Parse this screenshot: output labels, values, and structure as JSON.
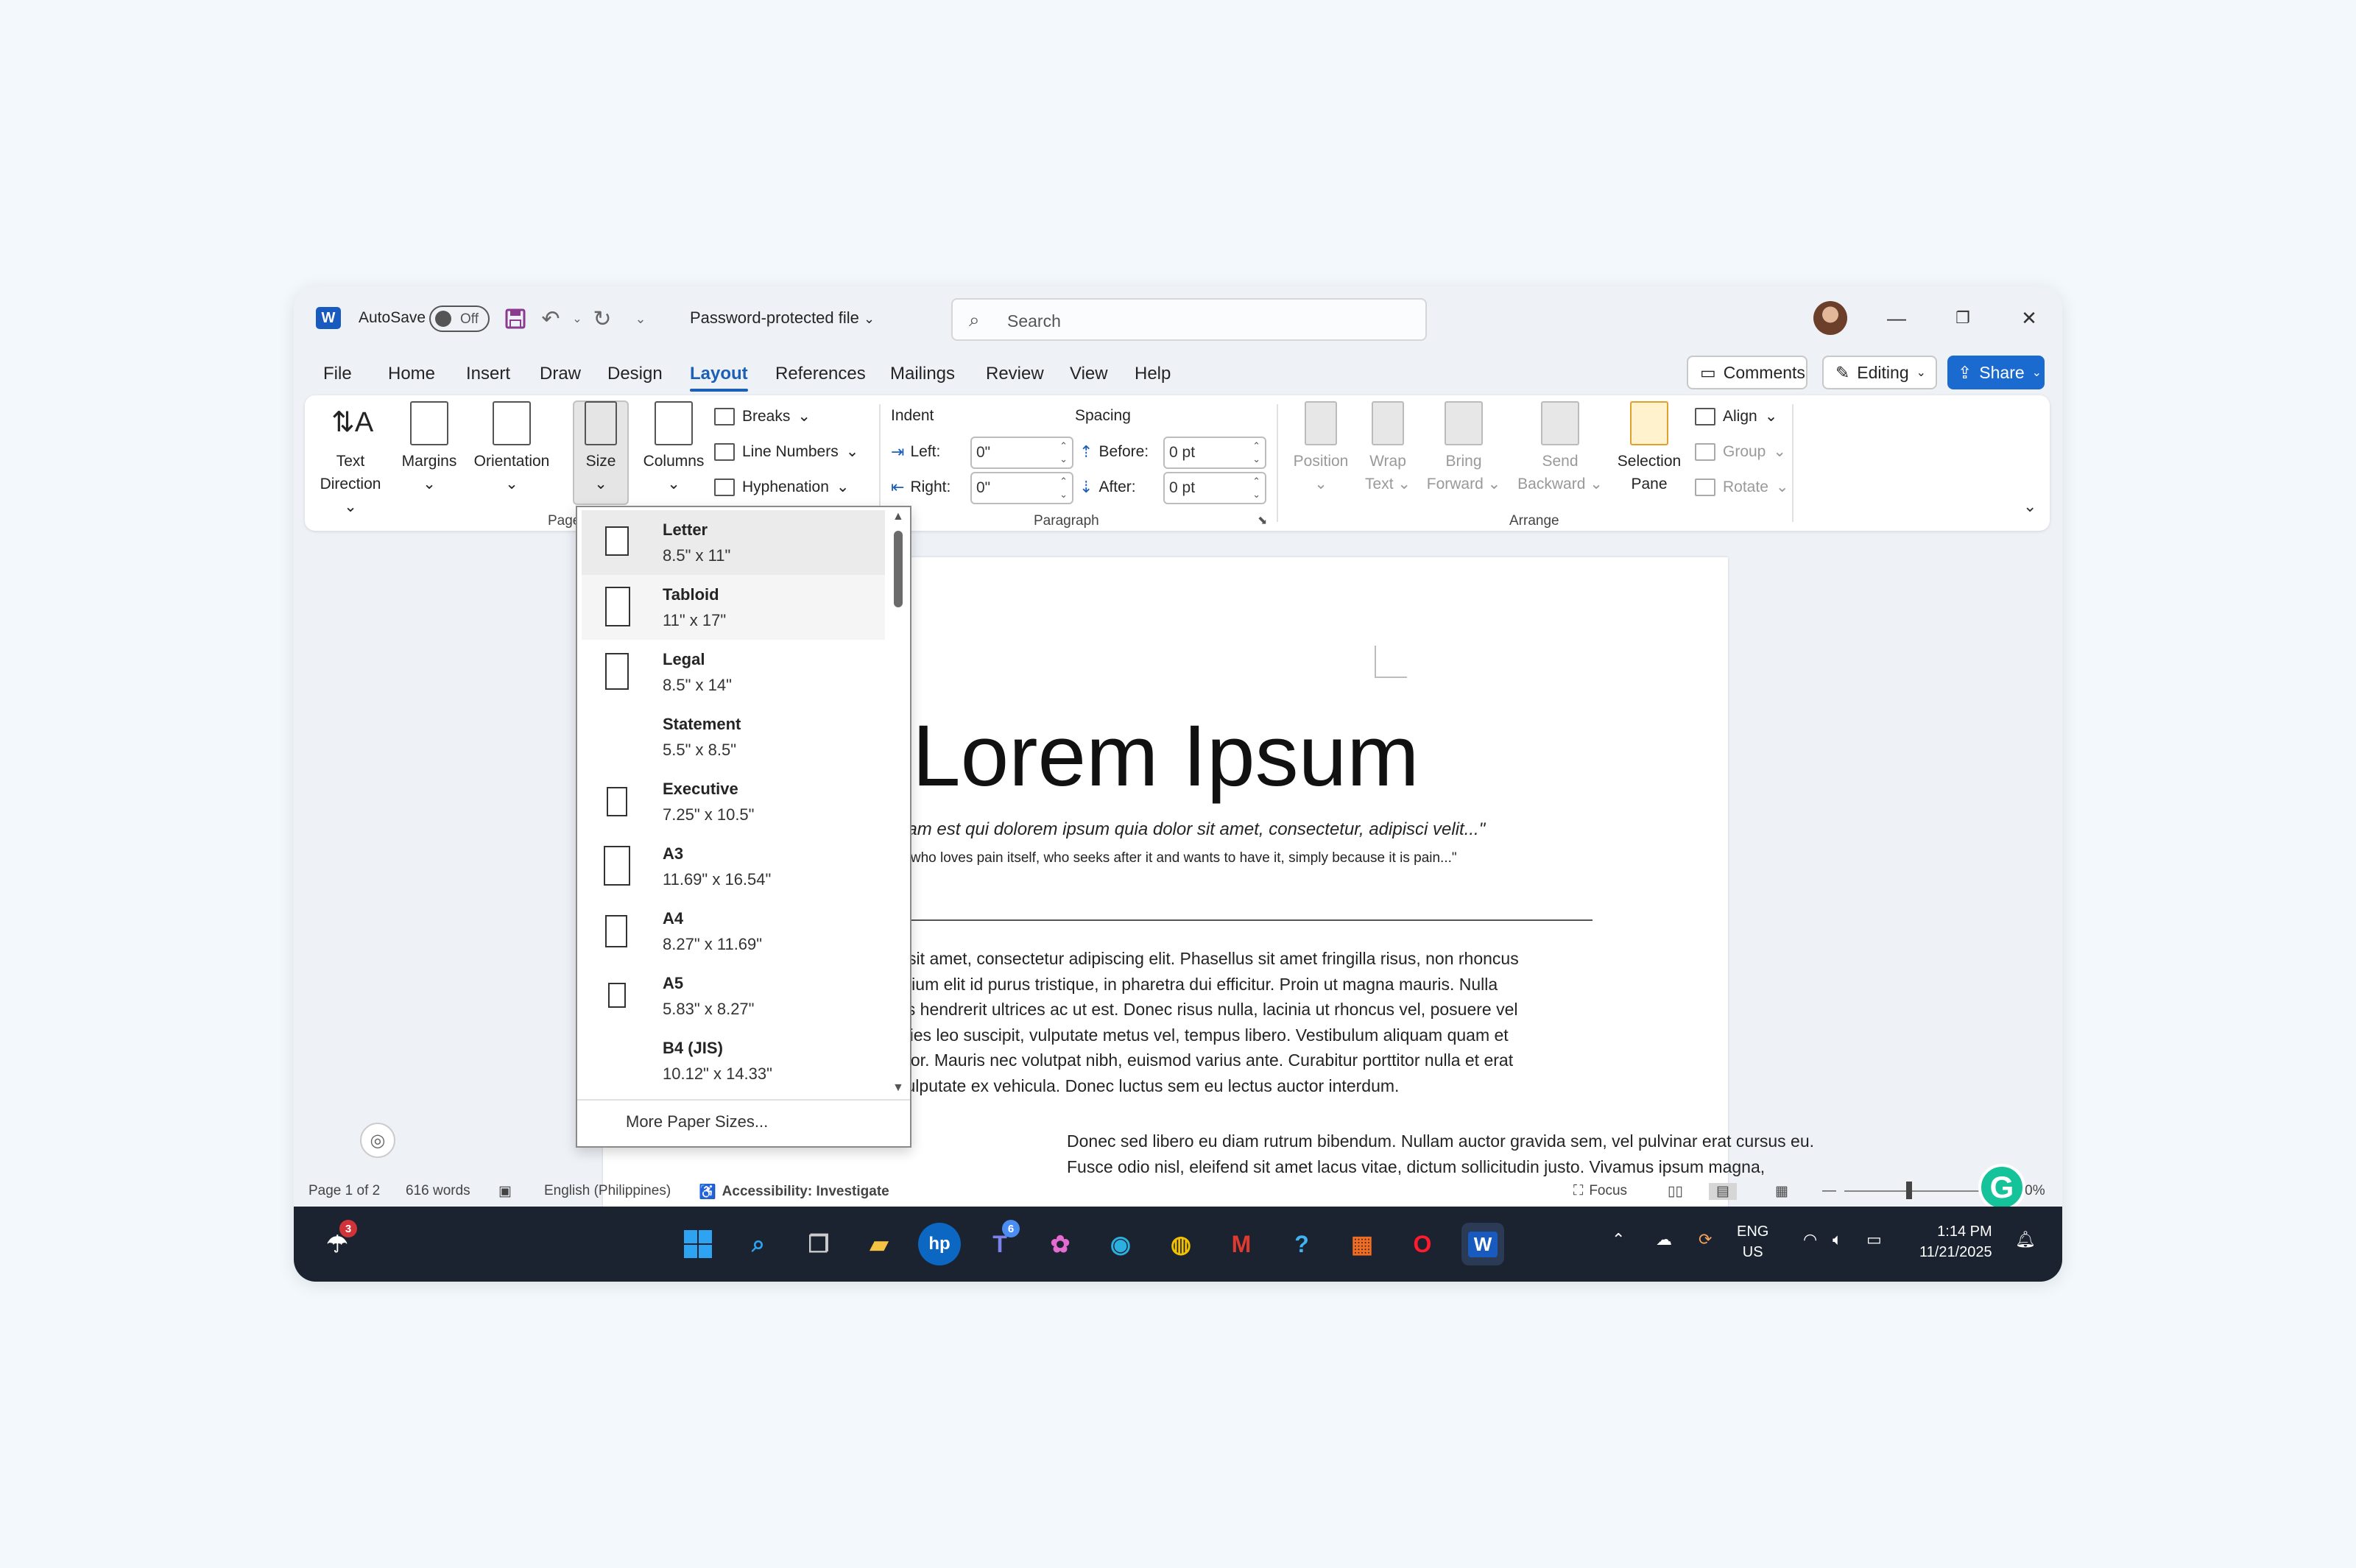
{
  "titlebar": {
    "app_logo": "W",
    "autosave_label": "AutoSave",
    "autosave_state": "Off",
    "doc_title": "Password-protected file",
    "search_placeholder": "Search"
  },
  "menu": {
    "tabs": [
      "File",
      "Home",
      "Insert",
      "Draw",
      "Design",
      "Layout",
      "References",
      "Mailings",
      "Review",
      "View",
      "Help"
    ],
    "active_tab": "Layout",
    "comments_label": "Comments",
    "editing_label": "Editing",
    "share_label": "Share"
  },
  "ribbon": {
    "page_setup": {
      "text_direction_1": "Text",
      "text_direction_2": "Direction",
      "margins": "Margins",
      "orientation": "Orientation",
      "size": "Size",
      "columns": "Columns",
      "breaks": "Breaks",
      "line_numbers": "Line Numbers",
      "hyphenation": "Hyphenation",
      "group_label": "Page"
    },
    "paragraph": {
      "indent_header": "Indent",
      "spacing_header": "Spacing",
      "left_label": "Left:",
      "right_label": "Right:",
      "before_label": "Before:",
      "after_label": "After:",
      "left_value": "0\"",
      "right_value": "0\"",
      "before_value": "0 pt",
      "after_value": "0 pt",
      "group_label": "Paragraph"
    },
    "arrange": {
      "position": "Position",
      "wrap_1": "Wrap",
      "wrap_2": "Text",
      "bring_1": "Bring",
      "bring_2": "Forward",
      "send_1": "Send",
      "send_2": "Backward",
      "selection_1": "Selection",
      "selection_2": "Pane",
      "align": "Align",
      "group": "Group",
      "rotate": "Rotate",
      "group_label": "Arrange"
    }
  },
  "size_menu": {
    "items": [
      {
        "name": "Letter",
        "dims": "8.5\" x 11\""
      },
      {
        "name": "Tabloid",
        "dims": "11\" x 17\""
      },
      {
        "name": "Legal",
        "dims": "8.5\" x 14\""
      },
      {
        "name": "Statement",
        "dims": "5.5\" x 8.5\""
      },
      {
        "name": "Executive",
        "dims": "7.25\" x 10.5\""
      },
      {
        "name": "A3",
        "dims": "11.69\" x 16.54\""
      },
      {
        "name": "A4",
        "dims": "8.27\" x 11.69\""
      },
      {
        "name": "A5",
        "dims": "5.83\" x 8.27\""
      },
      {
        "name": "B4 (JIS)",
        "dims": "10.12\" x 14.33\""
      }
    ],
    "selected": "Letter",
    "more_label": "More Paper Sizes..."
  },
  "document": {
    "heading": "Lorem Ipsum",
    "quote_latin": "uam est qui dolorem ipsum quia dolor sit amet, consectetur, adipisci velit...\"",
    "quote_english": "e who loves pain itself, who seeks after it and wants to have it, simply because it is pain...\"",
    "para1": [
      "r sit amet, consectetur adipiscing elit. Phasellus sit amet fringilla risus, non rhoncus",
      "etium elit id purus tristique, in pharetra dui efficitur. Proin ut magna mauris. Nulla",
      "us hendrerit ultrices ac ut est. Donec risus nulla, lacinia ut rhoncus vel, posuere vel",
      "icies leo suscipit, vulputate metus vel, tempus libero. Vestibulum aliquam quam et",
      "ctor. Mauris nec volutpat nibh, euismod varius ante. Curabitur porttitor nulla et erat",
      "vulputate ex vehicula. Donec luctus sem eu lectus auctor interdum."
    ],
    "para2": [
      "Donec sed libero eu diam rutrum bibendum. Nullam auctor gravida sem, vel pulvinar erat cursus eu.",
      "Fusce odio nisl, eleifend sit amet lacus vitae, dictum sollicitudin justo. Vivamus ipsum magna,"
    ]
  },
  "statusbar": {
    "page": "Page 1 of 2",
    "words": "616 words",
    "language": "English (Philippines)",
    "accessibility": "Accessibility: Investigate",
    "focus": "Focus",
    "zoom": "100%"
  },
  "taskbar": {
    "weather_badge": "3",
    "teams_badge": "6",
    "lang_1": "ENG",
    "lang_2": "US",
    "time": "1:14 PM",
    "date": "11/21/2025"
  }
}
